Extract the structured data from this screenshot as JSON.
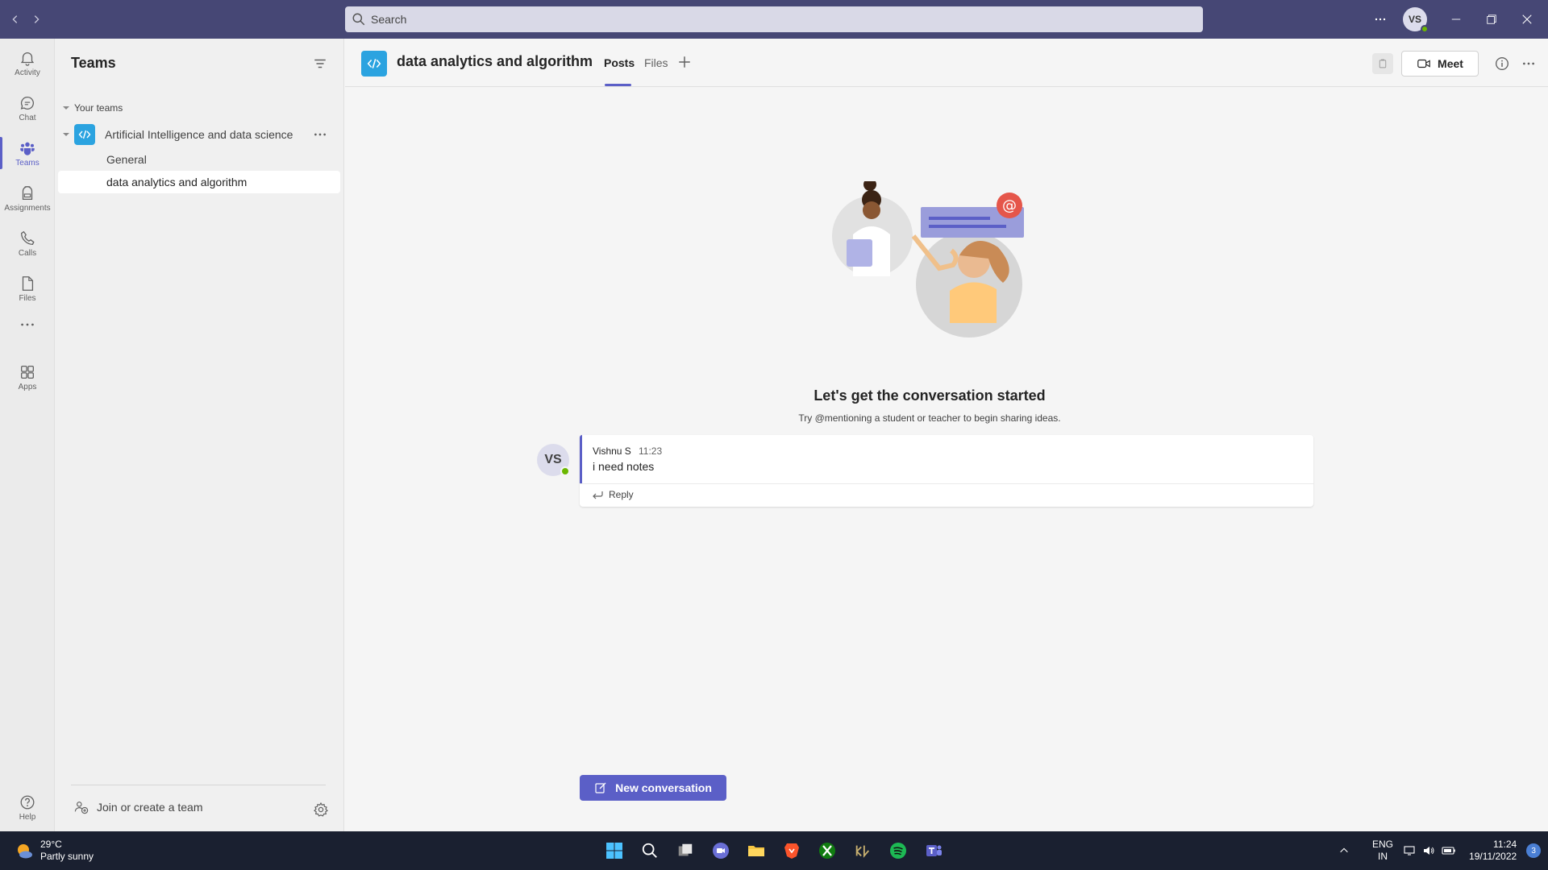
{
  "titlebar": {
    "search_placeholder": "Search",
    "avatar_initials": "VS"
  },
  "rail": {
    "items": [
      {
        "label": "Activity",
        "icon": "bell-icon"
      },
      {
        "label": "Chat",
        "icon": "chat-icon"
      },
      {
        "label": "Teams",
        "icon": "teams-icon",
        "active": true
      },
      {
        "label": "Assignments",
        "icon": "backpack-icon"
      },
      {
        "label": "Calls",
        "icon": "phone-icon"
      },
      {
        "label": "Files",
        "icon": "file-icon"
      },
      {
        "label": "",
        "icon": "more-icon"
      },
      {
        "label": "Apps",
        "icon": "apps-icon"
      },
      {
        "label": "Help",
        "icon": "help-icon"
      }
    ]
  },
  "teams_panel": {
    "title": "Teams",
    "section_label": "Your teams",
    "team_name": "Artificial Intelligence and data science",
    "channels": [
      "General",
      "data analytics and algorithm"
    ],
    "join_label": "Join or create a team"
  },
  "channel_header": {
    "name": "data analytics and algorithm",
    "tabs": [
      "Posts",
      "Files"
    ],
    "meet_label": "Meet"
  },
  "main": {
    "empty_title": "Let's get the conversation started",
    "empty_subtitle": "Try @mentioning a student or teacher to begin sharing ideas.",
    "message": {
      "avatar_initials": "VS",
      "author": "Vishnu S",
      "time": "11:23",
      "text": "i need notes",
      "reply_label": "Reply"
    },
    "new_conversation_label": "New conversation"
  },
  "taskbar": {
    "temperature": "29°C",
    "weather": "Partly sunny",
    "lang_top": "ENG",
    "lang_bottom": "IN",
    "time": "11:24",
    "date": "19/11/2022",
    "notification_count": "3"
  },
  "colors": {
    "titlebar": "#464775",
    "accent": "#5b5fc7",
    "team_avatar": "#2ba3e0",
    "presence": "#6bb700"
  }
}
